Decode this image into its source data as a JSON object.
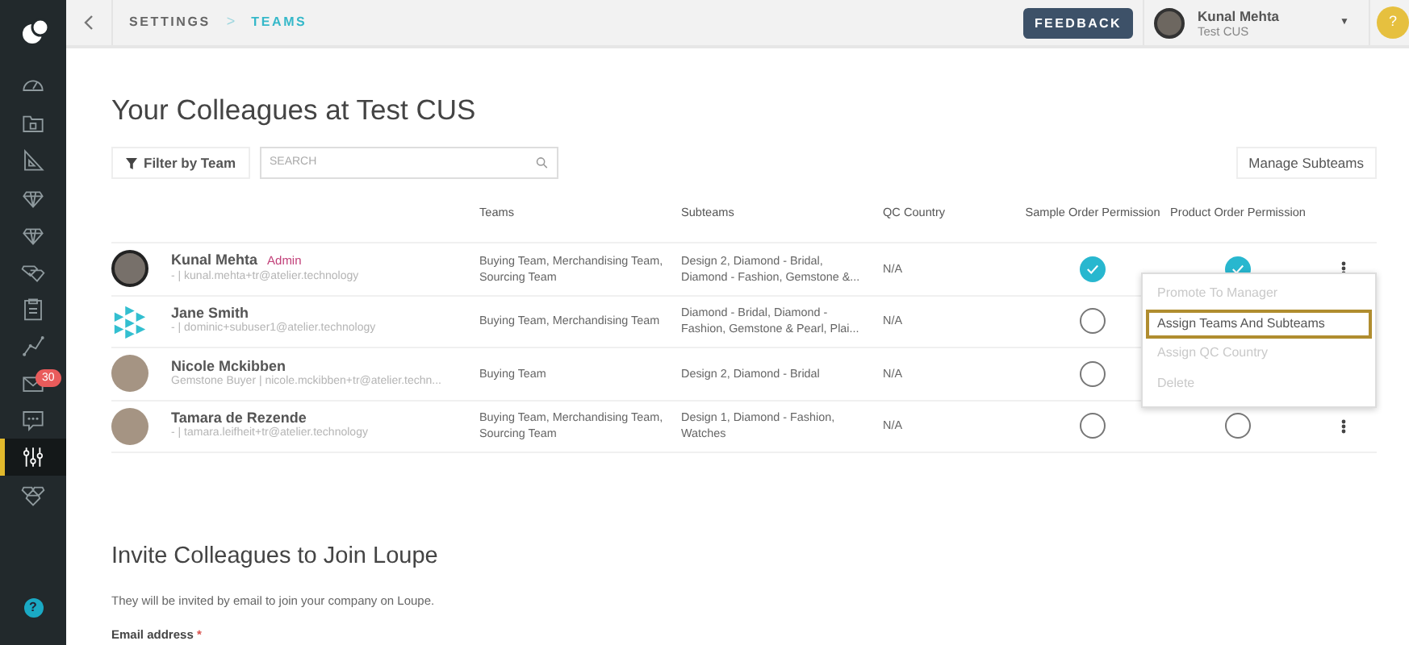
{
  "sidebar": {
    "items": [
      {
        "selected": false
      },
      {
        "selected": false
      },
      {
        "selected": false
      },
      {
        "selected": false
      },
      {
        "selected": false
      },
      {
        "selected": false
      },
      {
        "selected": false
      },
      {
        "selected": false
      },
      {
        "selected": false,
        "badge": "30"
      },
      {
        "selected": false
      },
      {
        "selected": true
      },
      {
        "selected": false
      }
    ],
    "help": "?"
  },
  "topbar": {
    "breadcrumb": [
      {
        "label": "SETTINGS",
        "selected": false
      },
      {
        "label": "TEAMS",
        "selected": true
      }
    ],
    "separator": ">",
    "feedback": "FEEDBACK",
    "user": {
      "name": "Kunal Mehta",
      "company": "Test CUS",
      "caret": "▼"
    },
    "help": "?"
  },
  "title": "Your Colleagues at Test CUS",
  "filter_button": "Filter by Team",
  "search": {
    "placeholder": "SEARCH"
  },
  "manage_button": "Manage Subteams",
  "table": {
    "columns": [
      "Teams",
      "Subteams",
      "QC Country",
      "Sample Order Permission",
      "Product Order Permission"
    ],
    "rows": [
      {
        "name": "Kunal Mehta",
        "role": "Admin",
        "detail": "- | kunal.mehta+tr@atelier.technology",
        "teams": "Buying Team, Merchandising Team, Sourcing Team",
        "subteams": "Design 2, Diamond - Bridal, Diamond - Fashion, Gemstone &...",
        "qc": "N/A",
        "sample_order": true,
        "product_order": true
      },
      {
        "name": "Jane Smith",
        "detail": "- | dominic+subuser1@atelier.technology",
        "teams": "Buying Team, Merchandising Team",
        "subteams": "Diamond - Bridal, Diamond - Fashion, Gemstone & Pearl, Plai...",
        "qc": "N/A",
        "sample_order": false
      },
      {
        "name": "Nicole Mckibben",
        "detail": "Gemstone Buyer | nicole.mckibben+tr@atelier.techn...",
        "teams": "Buying Team",
        "subteams": "Design 2, Diamond - Bridal",
        "qc": "N/A",
        "sample_order": false
      },
      {
        "name": "Tamara de Rezende",
        "detail": "- | tamara.leifheit+tr@atelier.technology",
        "teams": "Buying Team, Merchandising Team, Sourcing Team",
        "subteams": "Design 1, Diamond - Fashion, Watches",
        "qc": "N/A",
        "sample_order": false,
        "product_order": false
      }
    ]
  },
  "row_menu": {
    "items": [
      {
        "label": "Promote To Manager",
        "disabled": true,
        "selected": false
      },
      {
        "label": "Assign Teams And Subteams",
        "disabled": false,
        "selected": true
      },
      {
        "label": "Assign QC Country",
        "disabled": true,
        "selected": false
      },
      {
        "label": "Delete",
        "disabled": true,
        "selected": false
      }
    ]
  },
  "invite": {
    "title": "Invite Colleagues to Join Loupe",
    "text": "They will be invited by email to join your company on Loupe.",
    "email_label": "Email address",
    "required_mark": "*"
  }
}
